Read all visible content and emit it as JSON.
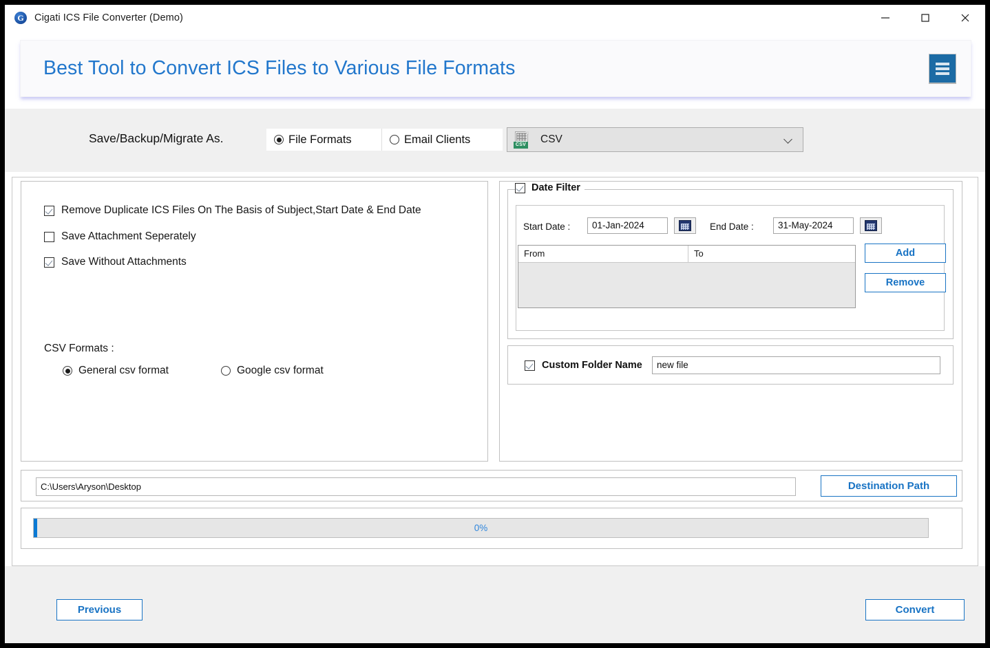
{
  "window": {
    "title": "Cigati ICS File Converter (Demo)",
    "app_icon": "cigati-logo-icon",
    "minimize": "minimize-icon",
    "maximize": "maximize-icon",
    "close": "close-icon"
  },
  "header": {
    "title": "Best Tool to Convert ICS Files to Various File Formats",
    "menu_icon": "hamburger-menu-icon",
    "accent_color": "#2277cc"
  },
  "save_as": {
    "label": "Save/Backup/Migrate As.",
    "options": [
      {
        "label": "File Formats",
        "selected": true
      },
      {
        "label": "Email Clients",
        "selected": false
      }
    ],
    "format_select": {
      "value": "CSV",
      "icon": "csv-file-icon",
      "badge": "CSV",
      "caret": "chevron-down-icon"
    }
  },
  "left_panel": {
    "checkboxes": [
      {
        "label": "Remove Duplicate ICS Files On The Basis of Subject,Start Date & End Date",
        "checked": true
      },
      {
        "label": "Save Attachment Seperately",
        "checked": false
      },
      {
        "label": "Save Without Attachments",
        "checked": true
      }
    ],
    "csv_formats_title": "CSV Formats :",
    "csv_format_options": [
      {
        "label": "General csv format",
        "selected": true
      },
      {
        "label": "Google csv format",
        "selected": false
      }
    ]
  },
  "right_panel": {
    "date_filter": {
      "label": "Date Filter",
      "checked": true,
      "start_label": "Start Date :",
      "start_value": "01-Jan-2024",
      "end_label": "End Date :",
      "end_value": "31-May-2024",
      "calendar_icon": "calendar-icon",
      "table": {
        "columns": [
          "From",
          "To"
        ],
        "rows": []
      },
      "add_label": "Add",
      "remove_label": "Remove"
    },
    "custom_folder": {
      "label": "Custom Folder Name",
      "checked": true,
      "value": "new file"
    }
  },
  "destination": {
    "path_value": "C:\\Users\\Aryson\\Desktop",
    "button_label": "Destination Path"
  },
  "progress": {
    "percent_text": "0%",
    "percent_value": 0,
    "fill_color": "#0b7ad4"
  },
  "footer": {
    "previous_label": "Previous",
    "convert_label": "Convert"
  }
}
